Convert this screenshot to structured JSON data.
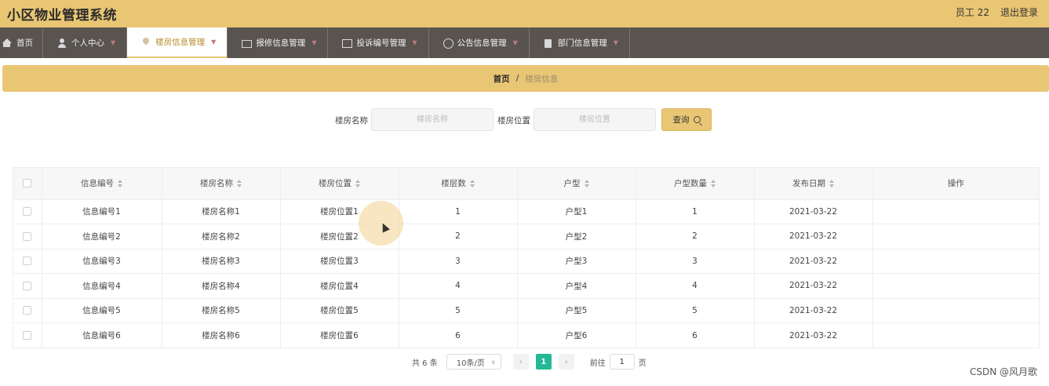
{
  "app": {
    "title": "小区物业管理系统"
  },
  "user": {
    "name": "员工 22",
    "logout": "退出登录"
  },
  "nav": {
    "items": [
      {
        "label": "首页",
        "icon": "home-icon"
      },
      {
        "label": "个人中心",
        "icon": "user-icon"
      },
      {
        "label": "楼房信息管理",
        "icon": "pin-icon",
        "active": true
      },
      {
        "label": "报修信息管理",
        "icon": "mail-icon"
      },
      {
        "label": "投诉编号管理",
        "icon": "card-icon"
      },
      {
        "label": "公告信息管理",
        "icon": "clock-icon"
      },
      {
        "label": "部门信息管理",
        "icon": "clipboard-icon"
      }
    ]
  },
  "breadcrumb": {
    "home": "首页",
    "separator": "/",
    "current": "楼房信息"
  },
  "search": {
    "name_label": "楼房名称",
    "name_placeholder": "楼房名称",
    "location_label": "楼房位置",
    "location_placeholder": "楼房位置",
    "button_label": "查询"
  },
  "table": {
    "headers": [
      "信息编号",
      "楼房名称",
      "楼房位置",
      "楼层数",
      "户型",
      "户型数量",
      "发布日期",
      "操作"
    ],
    "rows": [
      [
        "信息编号1",
        "楼房名称1",
        "楼房位置1",
        "1",
        "户型1",
        "1",
        "2021-03-22",
        ""
      ],
      [
        "信息编号2",
        "楼房名称2",
        "楼房位置2",
        "2",
        "户型2",
        "2",
        "2021-03-22",
        ""
      ],
      [
        "信息编号3",
        "楼房名称3",
        "楼房位置3",
        "3",
        "户型3",
        "3",
        "2021-03-22",
        ""
      ],
      [
        "信息编号4",
        "楼房名称4",
        "楼房位置4",
        "4",
        "户型4",
        "4",
        "2021-03-22",
        ""
      ],
      [
        "信息编号5",
        "楼房名称5",
        "楼房位置5",
        "5",
        "户型5",
        "5",
        "2021-03-22",
        ""
      ],
      [
        "信息编号6",
        "楼房名称6",
        "楼房位置6",
        "6",
        "户型6",
        "6",
        "2021-03-22",
        ""
      ]
    ]
  },
  "pagination": {
    "total": "共 6 条",
    "page_size": "10条/页",
    "prev": "‹",
    "current_page": "1",
    "next": "›",
    "goto_label": "前往",
    "goto_value": "1",
    "page_suffix": "页"
  },
  "watermark": "CSDN @风月歌",
  "colors": {
    "header": "#e8c673",
    "nav": "#595450",
    "accent": "#25b896"
  }
}
